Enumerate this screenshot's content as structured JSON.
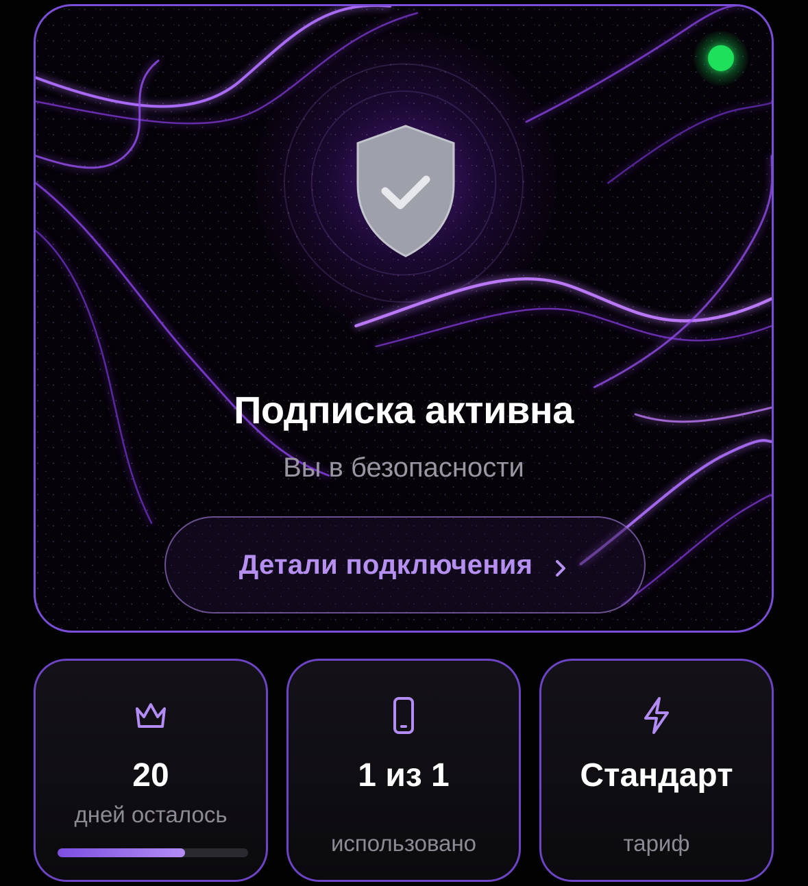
{
  "hero": {
    "title": "Подписка активна",
    "subtitle": "Вы в безопасности",
    "details_button_label": "Детали подключения",
    "status": "active",
    "status_color": "#1ee05a",
    "accent_color": "#7a4dd6",
    "shield_icon": "shield-check-icon",
    "details_icon": "chevron-right-icon"
  },
  "stats": [
    {
      "icon": "crown-icon",
      "value": "20",
      "label": "дней осталось",
      "progress": 0.67
    },
    {
      "icon": "phone-icon",
      "value": "1 из 1",
      "label": "использовано"
    },
    {
      "icon": "lightning-icon",
      "value": "Стандарт",
      "label": "тариф"
    }
  ]
}
